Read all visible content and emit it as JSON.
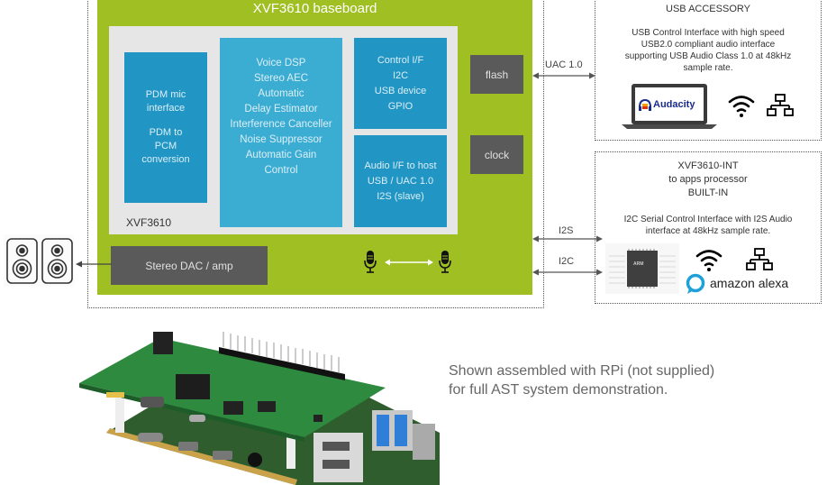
{
  "baseboard": {
    "title": "XVF3610 baseboard",
    "chip_label": "XVF3610",
    "blocks": {
      "pdm": {
        "lines": [
          "PDM mic",
          "interface",
          "",
          "PDM to",
          "PCM",
          "conversion"
        ]
      },
      "dsp": {
        "lines": [
          "Voice DSP",
          "Stereo AEC",
          "Automatic",
          "Delay Estimator",
          "Interference Canceller",
          "Noise Suppressor",
          "Automatic Gain",
          "Control"
        ]
      },
      "control": {
        "lines": [
          "Control I/F",
          "I2C",
          "USB device",
          "GPIO"
        ]
      },
      "audio": {
        "lines": [
          "Audio I/F to host",
          "USB / UAC 1.0",
          "I2S (slave)"
        ]
      }
    },
    "flash_label": "flash",
    "clock_label": "clock",
    "dac_label": "Stereo DAC / amp"
  },
  "links": {
    "uac": "UAC 1.0",
    "i2s": "I2S",
    "i2c": "I2C"
  },
  "usb_accessory": {
    "title": "USB ACCESSORY",
    "description": [
      "USB Control Interface with high speed",
      "USB2.0 compliant audio interface",
      "supporting USB Audio Class 1.0 at 48kHz",
      "sample rate."
    ],
    "app_name": "Audacity"
  },
  "builtin": {
    "title_lines": [
      "XVF3610-INT",
      "to apps processor",
      "BUILT-IN"
    ],
    "description": [
      "I2C Serial Control Interface with I2S Audio",
      "interface at 48kHz sample rate."
    ],
    "chip_text": "ARM",
    "assistant_name": "amazon alexa"
  },
  "caption": [
    "Shown assembled with RPi (not supplied)",
    "for full AST system demonstration."
  ],
  "colors": {
    "board_green": "#9fbf22",
    "block_blue_dark": "#2196c4",
    "block_blue_light": "#3cadd2",
    "component_grey": "#5a5a5a",
    "alexa_blue": "#1ea0d8"
  }
}
